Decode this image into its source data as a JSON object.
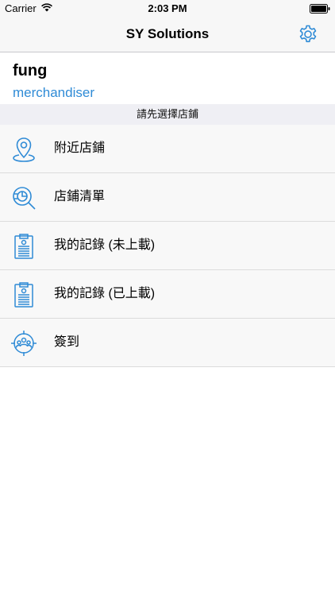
{
  "status_bar": {
    "carrier": "Carrier",
    "time": "2:03 PM"
  },
  "nav": {
    "title": "SY Solutions",
    "settings_icon": "gear-icon"
  },
  "user": {
    "name": "fung",
    "role": "merchandiser"
  },
  "hint": "請先選擇店鋪",
  "menu": {
    "items": [
      {
        "label": "附近店鋪",
        "icon": "location-pin-icon"
      },
      {
        "label": "店鋪清單",
        "icon": "store-search-icon"
      },
      {
        "label": "我的記錄 (未上載)",
        "icon": "clipboard-icon"
      },
      {
        "label": "我的記錄 (已上載)",
        "icon": "clipboard-icon"
      },
      {
        "label": "簽到",
        "icon": "check-in-target-icon"
      }
    ]
  },
  "colors": {
    "accent": "#2f8bd6",
    "bar_background": "#f7f7f7",
    "hint_background": "#efeff4",
    "row_background": "#f8f8f8"
  }
}
